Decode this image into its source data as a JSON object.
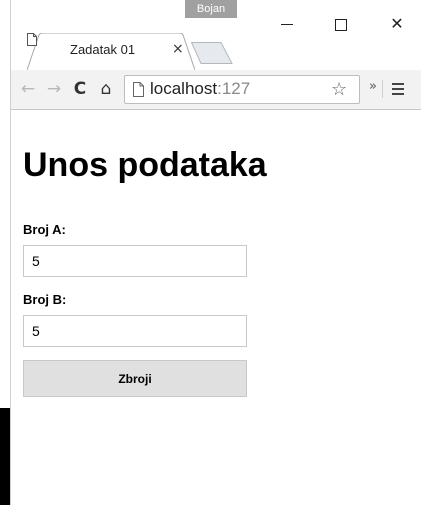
{
  "window": {
    "profile_name": "Bojan",
    "minimize_label": "–",
    "close_label": "✕"
  },
  "tab": {
    "title": "Zadatak 01",
    "close_label": "×"
  },
  "toolbar": {
    "back_icon": "←",
    "forward_icon": "→",
    "reload_icon": "C",
    "home_icon": "⌂",
    "url_host": "localhost",
    "url_port": ":127",
    "star_icon": "☆",
    "overflow_label": "»"
  },
  "page": {
    "title": "Unos podataka",
    "field_a_label": "Broj A:",
    "field_a_value": "5",
    "field_b_label": "Broj B:",
    "field_b_value": "5",
    "submit_label": "Zbroji"
  },
  "colors": {
    "toolbar_bg": "#f2f2f2",
    "button_bg": "#e0e0e0",
    "profile_badge": "#a0a0a0"
  }
}
